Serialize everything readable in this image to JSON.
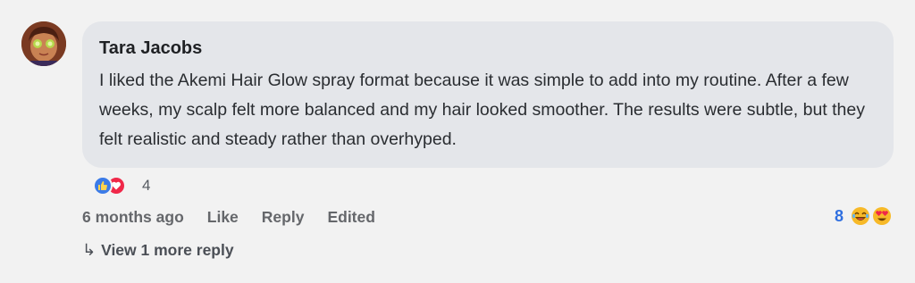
{
  "comment": {
    "author": "Tara Jacobs",
    "text": "I liked the Akemi Hair Glow spray format because it was simple to add into my routine. After a few weeks, my scalp felt more balanced and my hair looked smoother. The results were subtle, but they felt realistic and steady rather than overhyped.",
    "reaction_icons": [
      "like-icon",
      "love-icon"
    ],
    "reaction_count": "4",
    "actions": {
      "time": "6 months ago",
      "like": "Like",
      "reply": "Reply",
      "edited": "Edited"
    },
    "side_reactions": {
      "count": "8",
      "icons": [
        "laughing-emoji-icon",
        "heart-eyes-emoji-icon"
      ]
    },
    "view_more": "View 1 more reply"
  },
  "colors": {
    "bubble": "#e4e6ea",
    "like": "#3b7be8",
    "love": "#f02849",
    "count_blue": "#2f6fe0"
  }
}
